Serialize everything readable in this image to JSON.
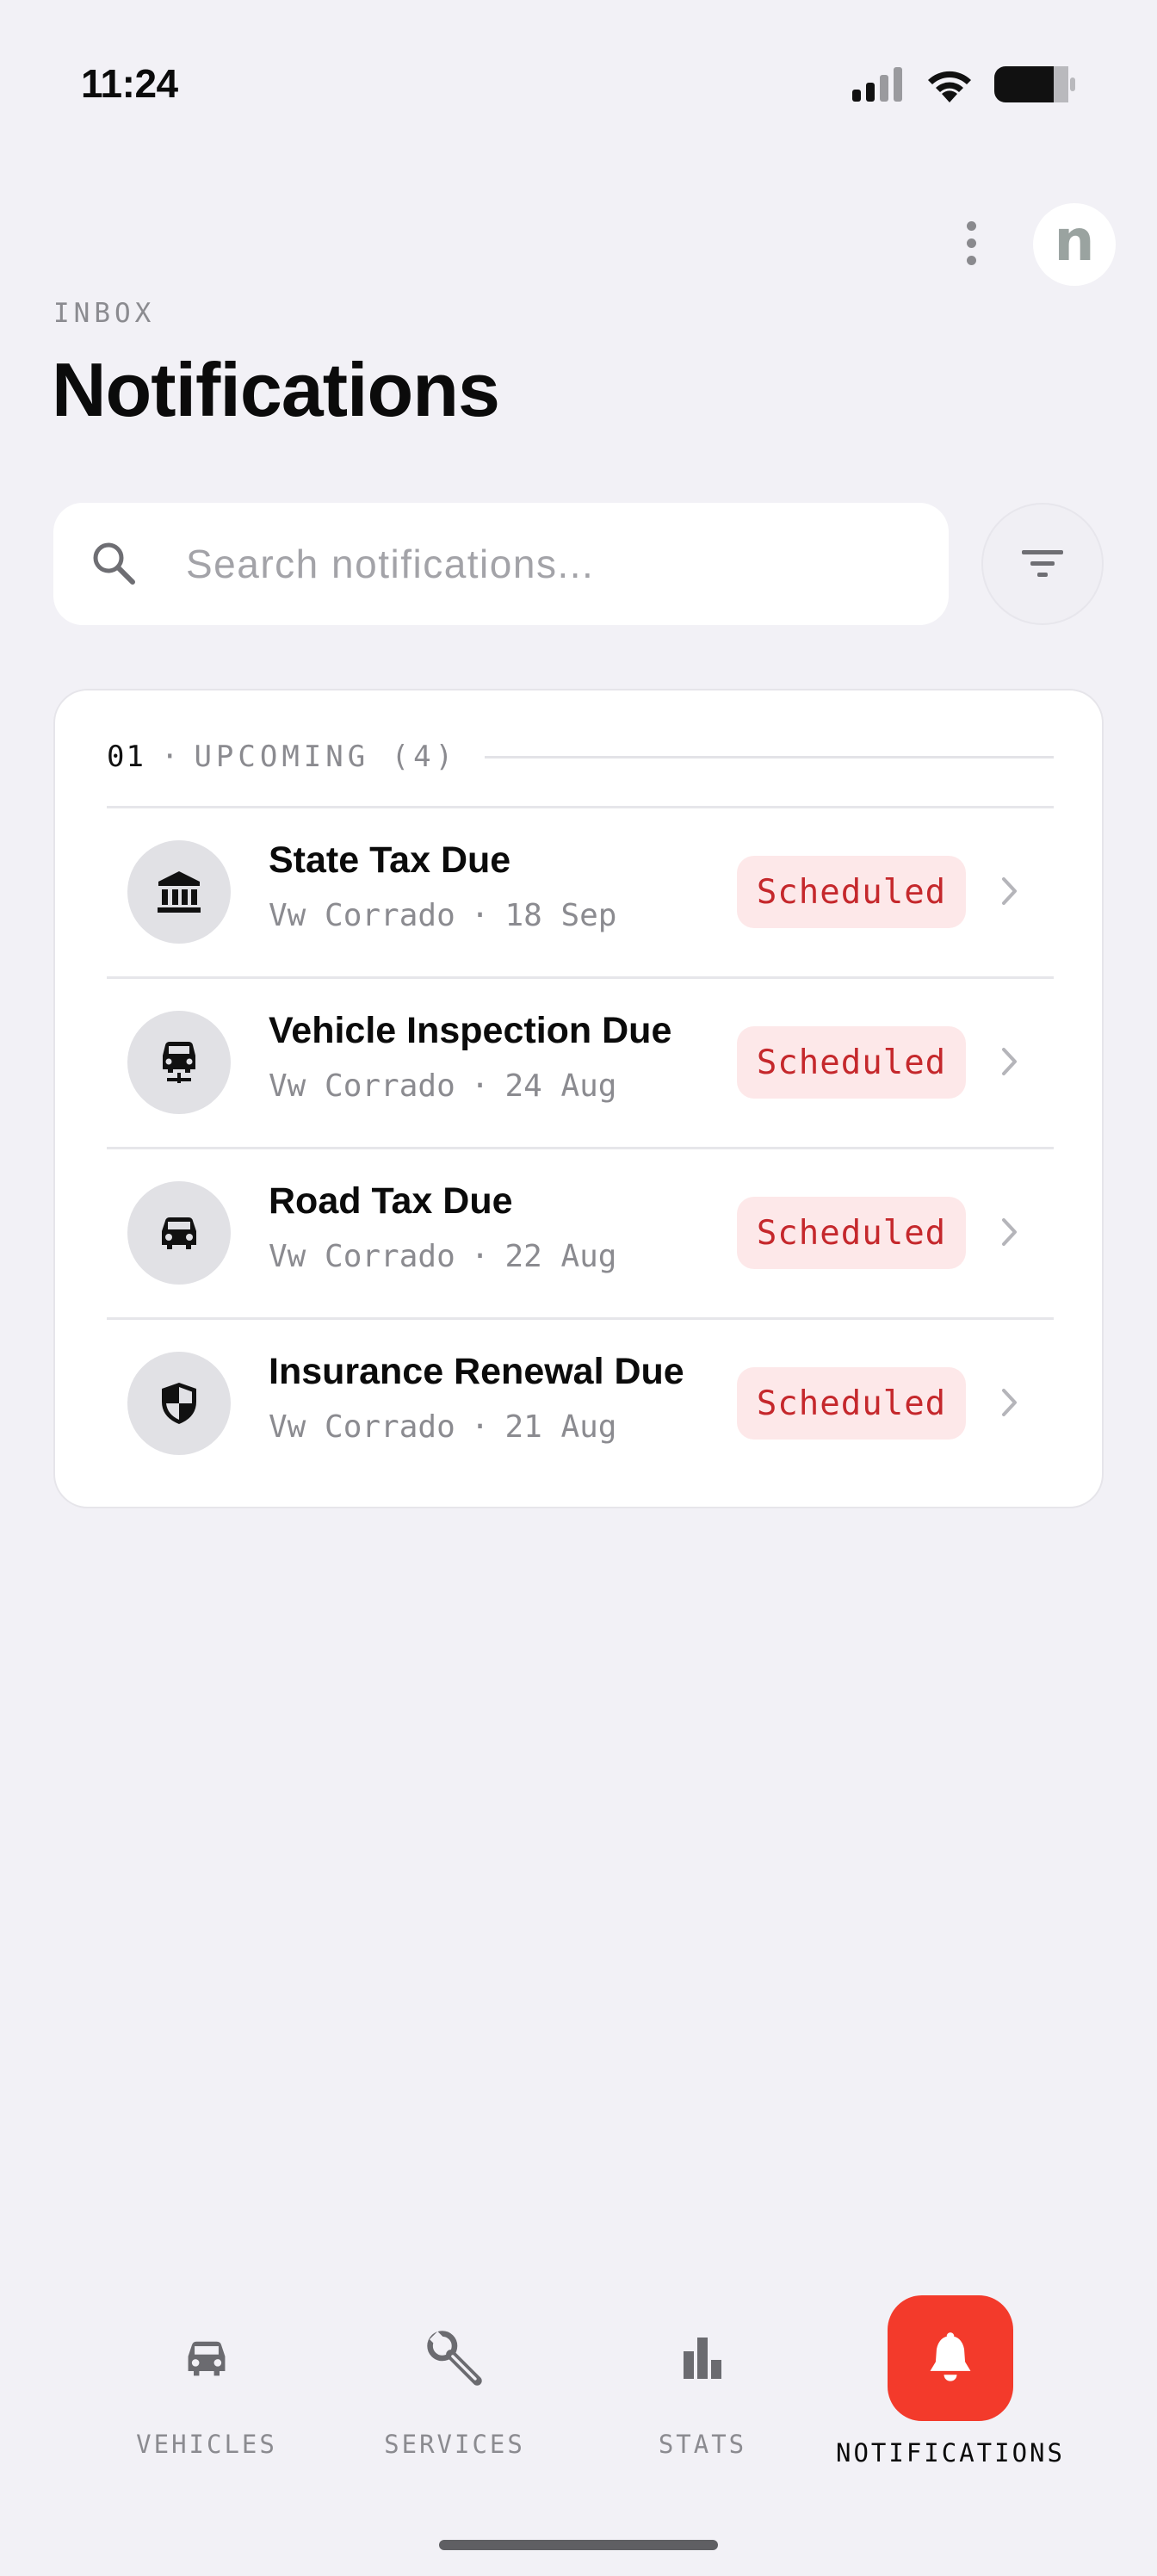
{
  "status_bar": {
    "time": "11:24"
  },
  "header": {
    "avatar_letter": "n",
    "eyebrow": "INBOX",
    "title": "Notifications"
  },
  "search": {
    "placeholder": "Search notifications..."
  },
  "section": {
    "number": "01",
    "label": "UPCOMING (4)"
  },
  "notifications": [
    {
      "icon": "bank-icon",
      "title": "State Tax Due",
      "vehicle": "Vw Corrado",
      "date": "18 Sep",
      "status": "Scheduled"
    },
    {
      "icon": "car-inspection-icon",
      "title": "Vehicle Inspection Due",
      "vehicle": "Vw Corrado",
      "date": "24 Aug",
      "status": "Scheduled"
    },
    {
      "icon": "car-icon",
      "title": "Road Tax Due",
      "vehicle": "Vw Corrado",
      "date": "22 Aug",
      "status": "Scheduled"
    },
    {
      "icon": "shield-icon",
      "title": "Insurance Renewal Due",
      "vehicle": "Vw Corrado",
      "date": "21 Aug",
      "status": "Scheduled"
    }
  ],
  "nav": {
    "items": [
      {
        "label": "VEHICLES",
        "icon": "car-icon"
      },
      {
        "label": "SERVICES",
        "icon": "wrench-icon"
      },
      {
        "label": "STATS",
        "icon": "bar-chart-icon"
      },
      {
        "label": "NOTIFICATIONS",
        "icon": "bell-icon",
        "active": true
      }
    ]
  },
  "colors": {
    "accent": "#f33a2b",
    "badge_bg": "#fde8e9",
    "badge_text": "#c5282c",
    "background": "#f2f1f6"
  }
}
